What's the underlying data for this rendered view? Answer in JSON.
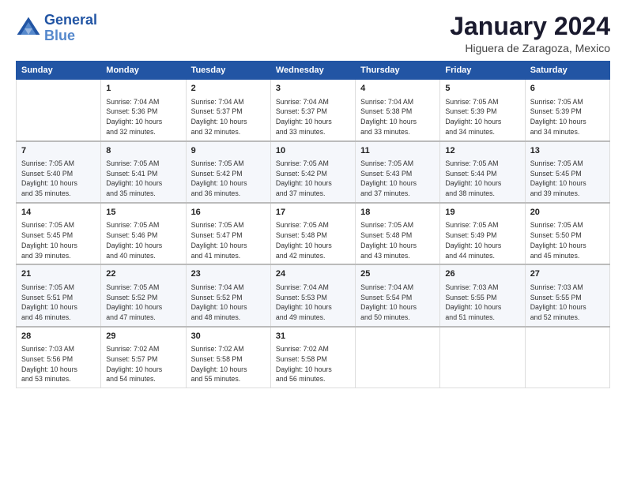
{
  "header": {
    "logo_line1": "General",
    "logo_line2": "Blue",
    "month": "January 2024",
    "location": "Higuera de Zaragoza, Mexico"
  },
  "weekdays": [
    "Sunday",
    "Monday",
    "Tuesday",
    "Wednesday",
    "Thursday",
    "Friday",
    "Saturday"
  ],
  "weeks": [
    [
      {
        "day": "",
        "info": ""
      },
      {
        "day": "1",
        "info": "Sunrise: 7:04 AM\nSunset: 5:36 PM\nDaylight: 10 hours\nand 32 minutes."
      },
      {
        "day": "2",
        "info": "Sunrise: 7:04 AM\nSunset: 5:37 PM\nDaylight: 10 hours\nand 32 minutes."
      },
      {
        "day": "3",
        "info": "Sunrise: 7:04 AM\nSunset: 5:37 PM\nDaylight: 10 hours\nand 33 minutes."
      },
      {
        "day": "4",
        "info": "Sunrise: 7:04 AM\nSunset: 5:38 PM\nDaylight: 10 hours\nand 33 minutes."
      },
      {
        "day": "5",
        "info": "Sunrise: 7:05 AM\nSunset: 5:39 PM\nDaylight: 10 hours\nand 34 minutes."
      },
      {
        "day": "6",
        "info": "Sunrise: 7:05 AM\nSunset: 5:39 PM\nDaylight: 10 hours\nand 34 minutes."
      }
    ],
    [
      {
        "day": "7",
        "info": "Sunrise: 7:05 AM\nSunset: 5:40 PM\nDaylight: 10 hours\nand 35 minutes."
      },
      {
        "day": "8",
        "info": "Sunrise: 7:05 AM\nSunset: 5:41 PM\nDaylight: 10 hours\nand 35 minutes."
      },
      {
        "day": "9",
        "info": "Sunrise: 7:05 AM\nSunset: 5:42 PM\nDaylight: 10 hours\nand 36 minutes."
      },
      {
        "day": "10",
        "info": "Sunrise: 7:05 AM\nSunset: 5:42 PM\nDaylight: 10 hours\nand 37 minutes."
      },
      {
        "day": "11",
        "info": "Sunrise: 7:05 AM\nSunset: 5:43 PM\nDaylight: 10 hours\nand 37 minutes."
      },
      {
        "day": "12",
        "info": "Sunrise: 7:05 AM\nSunset: 5:44 PM\nDaylight: 10 hours\nand 38 minutes."
      },
      {
        "day": "13",
        "info": "Sunrise: 7:05 AM\nSunset: 5:45 PM\nDaylight: 10 hours\nand 39 minutes."
      }
    ],
    [
      {
        "day": "14",
        "info": "Sunrise: 7:05 AM\nSunset: 5:45 PM\nDaylight: 10 hours\nand 39 minutes."
      },
      {
        "day": "15",
        "info": "Sunrise: 7:05 AM\nSunset: 5:46 PM\nDaylight: 10 hours\nand 40 minutes."
      },
      {
        "day": "16",
        "info": "Sunrise: 7:05 AM\nSunset: 5:47 PM\nDaylight: 10 hours\nand 41 minutes."
      },
      {
        "day": "17",
        "info": "Sunrise: 7:05 AM\nSunset: 5:48 PM\nDaylight: 10 hours\nand 42 minutes."
      },
      {
        "day": "18",
        "info": "Sunrise: 7:05 AM\nSunset: 5:48 PM\nDaylight: 10 hours\nand 43 minutes."
      },
      {
        "day": "19",
        "info": "Sunrise: 7:05 AM\nSunset: 5:49 PM\nDaylight: 10 hours\nand 44 minutes."
      },
      {
        "day": "20",
        "info": "Sunrise: 7:05 AM\nSunset: 5:50 PM\nDaylight: 10 hours\nand 45 minutes."
      }
    ],
    [
      {
        "day": "21",
        "info": "Sunrise: 7:05 AM\nSunset: 5:51 PM\nDaylight: 10 hours\nand 46 minutes."
      },
      {
        "day": "22",
        "info": "Sunrise: 7:05 AM\nSunset: 5:52 PM\nDaylight: 10 hours\nand 47 minutes."
      },
      {
        "day": "23",
        "info": "Sunrise: 7:04 AM\nSunset: 5:52 PM\nDaylight: 10 hours\nand 48 minutes."
      },
      {
        "day": "24",
        "info": "Sunrise: 7:04 AM\nSunset: 5:53 PM\nDaylight: 10 hours\nand 49 minutes."
      },
      {
        "day": "25",
        "info": "Sunrise: 7:04 AM\nSunset: 5:54 PM\nDaylight: 10 hours\nand 50 minutes."
      },
      {
        "day": "26",
        "info": "Sunrise: 7:03 AM\nSunset: 5:55 PM\nDaylight: 10 hours\nand 51 minutes."
      },
      {
        "day": "27",
        "info": "Sunrise: 7:03 AM\nSunset: 5:55 PM\nDaylight: 10 hours\nand 52 minutes."
      }
    ],
    [
      {
        "day": "28",
        "info": "Sunrise: 7:03 AM\nSunset: 5:56 PM\nDaylight: 10 hours\nand 53 minutes."
      },
      {
        "day": "29",
        "info": "Sunrise: 7:02 AM\nSunset: 5:57 PM\nDaylight: 10 hours\nand 54 minutes."
      },
      {
        "day": "30",
        "info": "Sunrise: 7:02 AM\nSunset: 5:58 PM\nDaylight: 10 hours\nand 55 minutes."
      },
      {
        "day": "31",
        "info": "Sunrise: 7:02 AM\nSunset: 5:58 PM\nDaylight: 10 hours\nand 56 minutes."
      },
      {
        "day": "",
        "info": ""
      },
      {
        "day": "",
        "info": ""
      },
      {
        "day": "",
        "info": ""
      }
    ]
  ]
}
